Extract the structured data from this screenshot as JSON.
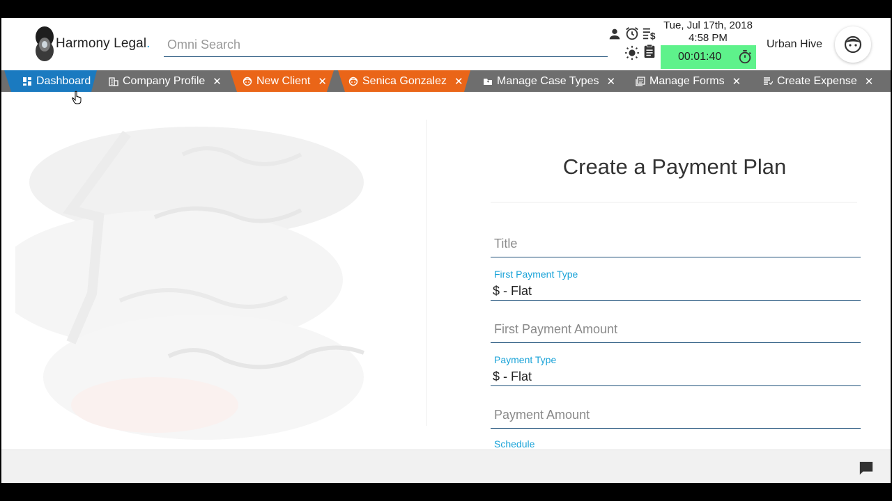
{
  "header": {
    "brand_name": "Harmony Legal",
    "brand_dot": ".",
    "search_placeholder": "Omni Search",
    "date": "Tue, Jul 17th, 2018",
    "time": "4:58 PM",
    "timer": "00:01:40",
    "user_name": "Urban Hive",
    "icons": [
      "person-icon",
      "alarm-icon",
      "billing-icon",
      "brightness-icon",
      "clipboard-icon",
      "stopwatch-icon"
    ]
  },
  "tabs": [
    {
      "label": "Dashboard",
      "icon": "dashboard-icon",
      "color": "#1a7ac0",
      "closable": false
    },
    {
      "label": "Company Profile",
      "icon": "building-icon",
      "color": "#6e6e6e",
      "closable": true
    },
    {
      "label": "New Client",
      "icon": "face-icon",
      "color": "#ea6518",
      "closable": true
    },
    {
      "label": "Senica Gonzalez",
      "icon": "face-icon",
      "color": "#ea6518",
      "closable": true
    },
    {
      "label": "Manage Case Types",
      "icon": "folder-icon",
      "color": "#6e6e6e",
      "closable": true
    },
    {
      "label": "Manage Forms",
      "icon": "forms-icon",
      "color": "#6e6e6e",
      "closable": true
    },
    {
      "label": "Create Expense",
      "icon": "list-icon",
      "color": "#6e6e6e",
      "closable": true
    }
  ],
  "close_glyph": "✕",
  "form": {
    "title": "Create a Payment Plan",
    "fields": {
      "title": {
        "placeholder": "Title"
      },
      "first_payment_type": {
        "label": "First Payment Type",
        "value": "$ - Flat"
      },
      "first_payment_amount": {
        "placeholder": "First Payment Amount"
      },
      "payment_type": {
        "label": "Payment Type",
        "value": "$ - Flat"
      },
      "payment_amount": {
        "placeholder": "Payment Amount"
      },
      "schedule": {
        "label": "Schedule"
      }
    }
  },
  "colors": {
    "accent_blue": "#1a7ac0",
    "accent_orange": "#ea6518",
    "timer_green": "#5ef28b",
    "label_cyan": "#1aa3d8",
    "underline_navy": "#1b4e78"
  }
}
